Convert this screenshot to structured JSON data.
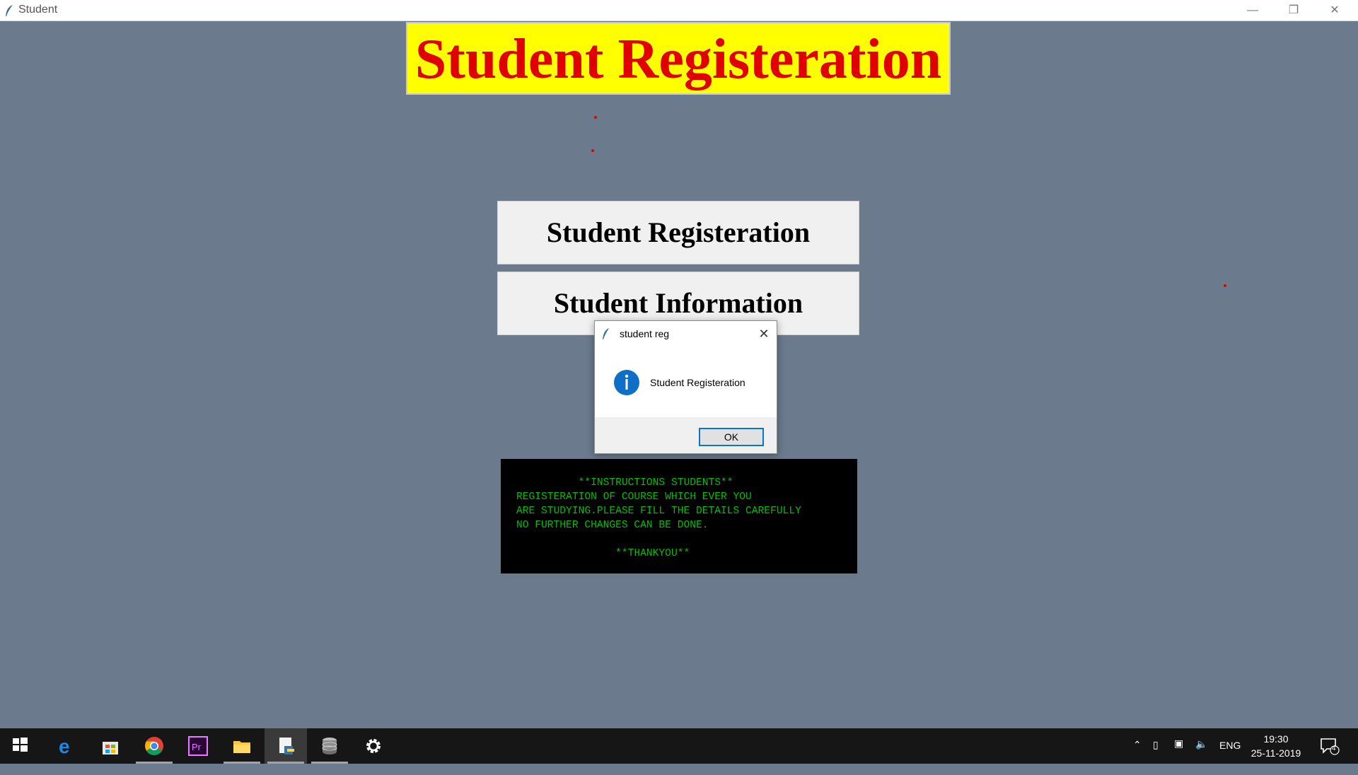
{
  "window": {
    "title": "Student",
    "controls": [
      "minimize",
      "restore",
      "close"
    ]
  },
  "banner": {
    "text": "Student Registeration"
  },
  "buttons": {
    "registration": "Student Registeration",
    "information": "Student Information"
  },
  "instructions": {
    "text": "          **INSTRUCTIONS STUDENTS**\nREGISTERATION OF COURSE WHICH EVER YOU\nARE STUDYING.PLEASE FILL THE DETAILS CAREFULLY\nNO FURTHER CHANGES CAN BE DONE.\n\n                **THANKYOU**"
  },
  "dialog": {
    "title": "student reg",
    "message": "Student Registeration",
    "ok_label": "OK",
    "icon": "info-icon"
  },
  "taskbar": {
    "items": [
      "windows-start-icon",
      "edge-icon",
      "store-icon",
      "chrome-icon",
      "premiere-icon",
      "file-explorer-icon",
      "python-editor-icon",
      "database-icon",
      "settings-icon"
    ],
    "language": "ENG",
    "time": "19:30",
    "date": "25-11-2019",
    "notification_count": "4"
  },
  "colors": {
    "background": "#6b7a8c",
    "banner_bg": "#ffff00",
    "banner_text": "#e10000",
    "instructions_text": "#00c000"
  }
}
